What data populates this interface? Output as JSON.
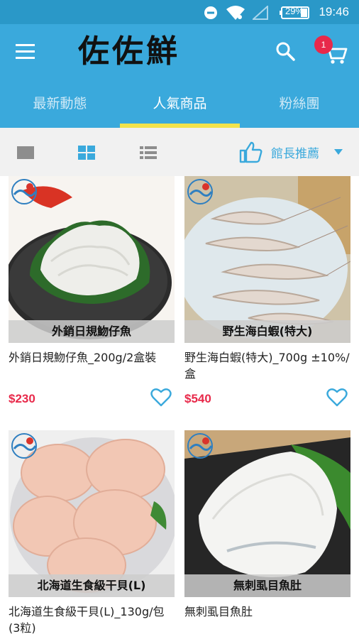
{
  "status": {
    "battery": "29%",
    "time": "19:46"
  },
  "app": {
    "logo_text": "佐佐鮮",
    "cart_count": "1"
  },
  "tabs": [
    {
      "label": "最新動態"
    },
    {
      "label": "人氣商品"
    },
    {
      "label": "粉絲團"
    }
  ],
  "sort": {
    "label": "館長推薦"
  },
  "products": [
    {
      "caption": "外銷日規魩仔魚",
      "title": "外銷日規魩仔魚_200g/2盒裝",
      "price": "$230"
    },
    {
      "caption": "野生海白蝦(特大)",
      "title": "野生海白蝦(特大)_700g ±10%/盒",
      "price": "$540"
    },
    {
      "caption": "北海道生食級干貝(L)",
      "title": "北海道生食級干貝(L)_130g/包(3粒)",
      "price": ""
    },
    {
      "caption": "無刺虱目魚肚",
      "title": "無刺虱目魚肚",
      "price": ""
    }
  ],
  "colors": {
    "primary": "#3aa9dc",
    "status_bar": "#2a98c8",
    "indicator": "#f2e34c",
    "price": "#e8294a"
  }
}
